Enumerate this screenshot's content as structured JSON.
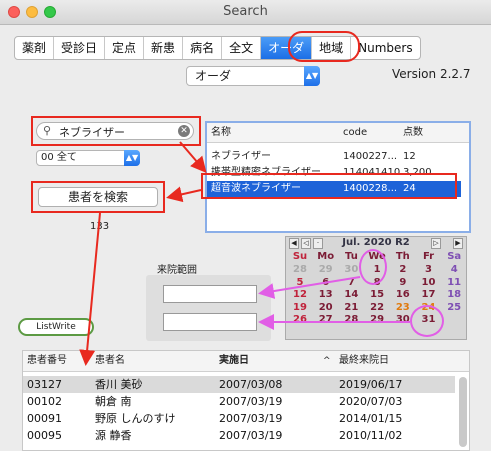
{
  "window": {
    "title": "Search"
  },
  "tabs": [
    "薬剤",
    "受診日",
    "定点",
    "新患",
    "病名",
    "全文",
    "オーダ",
    "地域",
    "Numbers"
  ],
  "order_popup": {
    "value": "オーダ"
  },
  "version": "Version 2.2.7",
  "search": {
    "value": "ネブライザー"
  },
  "filter_popup": {
    "value": "00 全て"
  },
  "search_button": {
    "label": "患者を検索"
  },
  "result_count": "133",
  "order_table": {
    "headers": [
      "名称",
      "code",
      "点数"
    ],
    "rows": [
      {
        "name": "ネブライザー",
        "code": "1400227...",
        "points": "12"
      },
      {
        "name": "携帯型精密ネブライザー...",
        "code": "114041410",
        "points": "3,200"
      },
      {
        "name": "超音波ネブライザー",
        "code": "1400228...",
        "points": "24",
        "selected": true
      }
    ]
  },
  "calendar": {
    "title": "Jul. 2020 R2",
    "weekdays": [
      "Su",
      "Mo",
      "Tu",
      "We",
      "Th",
      "Fr",
      "Sa"
    ],
    "prev_days": [
      "28",
      "29",
      "30"
    ],
    "days": [
      "1",
      "2",
      "3",
      "4",
      "5",
      "6",
      "7",
      "8",
      "9",
      "10",
      "11",
      "12",
      "13",
      "14",
      "15",
      "16",
      "17",
      "18",
      "19",
      "20",
      "21",
      "22",
      "23",
      "24",
      "25",
      "26",
      "27",
      "28",
      "29",
      "30",
      "31"
    ],
    "colors": {
      "sunday": "#c0233b",
      "saturday": "#7e4fb3",
      "weekday": "#7b1c35",
      "holiday": "#e07b10"
    }
  },
  "range": {
    "label": "来院範囲",
    "from": "",
    "to": ""
  },
  "listwrite_button": {
    "label": "ListWrite"
  },
  "patient_table": {
    "headers": [
      "患者番号",
      "患者名",
      "実施日",
      "最終来院日"
    ],
    "rows": [
      [
        "03127",
        "香川 美砂",
        "2007/03/08",
        "2019/06/17"
      ],
      [
        "00102",
        "朝倉 南",
        "2007/03/19",
        "2020/07/03"
      ],
      [
        "00091",
        "野原 しんのすけ",
        "2007/03/19",
        "2014/01/15"
      ],
      [
        "00095",
        "源 静香",
        "2007/03/19",
        "2010/11/02"
      ]
    ]
  }
}
